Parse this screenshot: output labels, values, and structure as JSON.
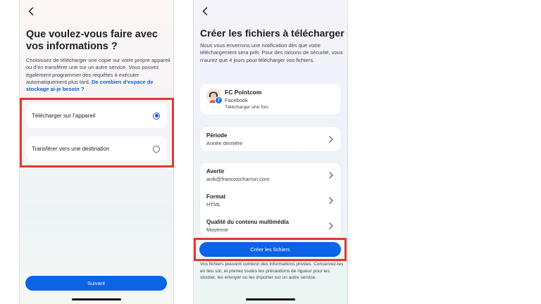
{
  "screen1": {
    "title": "Que voulez-vous faire avec vos informations ?",
    "description": "Choisissez de télécharger une copie sur votre propre appareil ou d’en transférer une sur un autre service. Vous pouvez également programmer des requêtes à exécuter automatiquement plus tard.",
    "help_link": "De combien d’espace de stockage ai-je besoin ?",
    "options": [
      {
        "label": "Télécharger sur l’appareil",
        "selected": true
      },
      {
        "label": "Transférer vers une destination",
        "selected": false
      }
    ],
    "next_button": "Suivant"
  },
  "screen2": {
    "title": "Créer les fichiers à télécharger",
    "description": "Nous vous enverrons une notification dès que votre téléchargement sera prêt. Pour des raisons de sécurité, vous n’aurez que 4 jours pour télécharger vos fichiers.",
    "account": {
      "name": "FC Pointcom",
      "source": "Facebook",
      "note": "Télécharger une fois"
    },
    "period": {
      "label": "Période",
      "value": "Année dernière"
    },
    "settings": [
      {
        "label": "Avertir",
        "value": "anik@francoischarron.com"
      },
      {
        "label": "Format",
        "value": "HTML"
      },
      {
        "label": "Qualité du contenu multimédia",
        "value": "Moyenne"
      }
    ],
    "create_button": "Créer les fichiers",
    "footer": "Vos fichiers peuvent contenir des informations privées. Conservez-les en lieu sûr, et prenez toutes les précautions de rigueur pour les stocker, les envoyer ou les importer sur un autre service."
  },
  "colors": {
    "accent_blue": "#0b63e5",
    "highlight_red": "#e2392f",
    "link_blue": "#0d5fce"
  },
  "icons": [
    "back-arrow-icon",
    "radio-icon",
    "chevron-right-icon",
    "avatar-icon",
    "facebook-icon"
  ]
}
